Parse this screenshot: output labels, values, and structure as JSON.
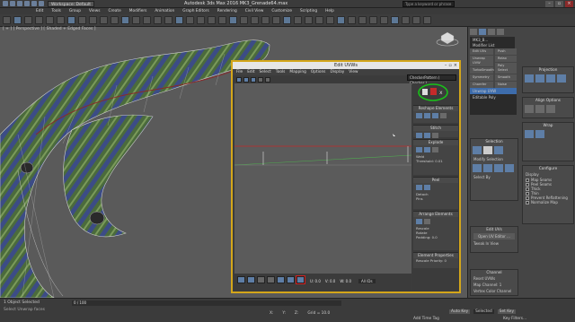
{
  "titlebar": {
    "workspace": "Workspace: Default",
    "title": "Autodesk 3ds Max 2016    MK3_Grenade64.max",
    "search_placeholder": "Type a keyword or phrase"
  },
  "menubar": [
    "Edit",
    "Tools",
    "Group",
    "Views",
    "Create",
    "Modifiers",
    "Animation",
    "Graph Editors",
    "Rendering",
    "Civil View",
    "Customize",
    "Scripting",
    "Help"
  ],
  "viewport": {
    "label": "[ + ] [ Perspective ] [ Shaded + Edged Faces ]"
  },
  "uvw": {
    "title": "Edit UVWs",
    "menu": [
      "File",
      "Edit",
      "Select",
      "Tools",
      "Mapping",
      "Options",
      "Display",
      "View"
    ],
    "checker": "CheckerPattern ( Checker )",
    "sections": {
      "quick_transform": "Quick Transform",
      "reshape": "Reshape Elements",
      "stitch": "Stitch",
      "explode": "Explode",
      "weld": "Weld",
      "threshold": "Threshold: 0.01",
      "peel": "Peel",
      "detach": "Detach",
      "pins": "Pins",
      "arrange": "Arrange Elements",
      "rescale": "Rescale",
      "rotate": "Rotate",
      "padding": "Padding: 0.0",
      "element_props": "Element Properties",
      "rescale_priority": "Rescale Priority: 0"
    },
    "bottom": {
      "u": "U: 0.0",
      "v": "V: 0.0",
      "w": "W: 0.0",
      "all_ids": "All IDs"
    }
  },
  "cmdpanel": {
    "modifier_list": "Modifier List",
    "stack": [
      "Unwrap UVW",
      "Editable Poly"
    ],
    "object_name": "MK3_B...",
    "buttons_left": [
      "Edit UVs",
      "Unwrap UVW",
      "TurboSmooth",
      "Symmetry",
      "Chamfer",
      "Shell"
    ],
    "buttons_right": [
      "Push",
      "Relax",
      "Poly Select",
      "Smooth",
      "Noise",
      "Slice"
    ],
    "selection": "Selection",
    "modify_selection": "Modify Selection",
    "select_by": "Select By",
    "edit_uvs": "Edit UVs",
    "open_editor": "Open UV Editor ...",
    "tweak": "Tweak In View",
    "channel": "Channel",
    "reset_uvws": "Reset UVWs",
    "save": "Save...",
    "load": "Load...",
    "map_channel": "Map Channel:  1",
    "vertex_color": "Vertex Color Channel",
    "projection": "Projection",
    "align_options": "Align Options",
    "wrap": "Wrap",
    "configure": "Configure",
    "display_label": "Display",
    "map_seams": "Map Seams",
    "peel_seams": "Peel Seams",
    "thick": "Thick",
    "thin": "Thin",
    "prevent_reflattening": "Prevent Reflattening",
    "normalize_map": "Normalize Map"
  },
  "statusbar": {
    "selected": "1 Object Selected",
    "prompt": "Select Unwrap faces",
    "frame": "0 / 100",
    "x": "X:",
    "y": "Y:",
    "z": "Z:",
    "grid": "Grid = 10.0",
    "auto_key": "Auto Key",
    "selected_drop": "Selected",
    "set_key": "Set Key",
    "key_filters": "Key Filters...",
    "add_time_tag": "Add Time Tag"
  }
}
